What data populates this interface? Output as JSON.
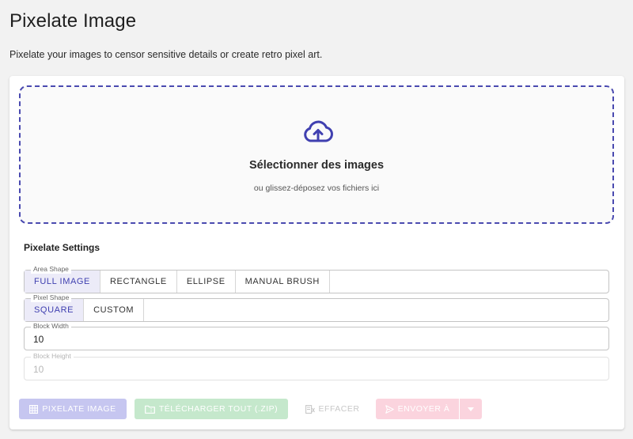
{
  "header": {
    "title": "Pixelate Image",
    "subtitle": "Pixelate your images to censor sensitive details or create retro pixel art."
  },
  "dropzone": {
    "title": "Sélectionner des images",
    "subtitle": "ou glissez-déposez vos fichiers ici",
    "icon": "cloud-upload-icon"
  },
  "settings": {
    "title": "Pixelate Settings",
    "area_shape": {
      "label": "Area Shape",
      "options": [
        "FULL IMAGE",
        "RECTANGLE",
        "ELLIPSE",
        "MANUAL BRUSH"
      ],
      "selected": "FULL IMAGE"
    },
    "pixel_shape": {
      "label": "Pixel Shape",
      "options": [
        "SQUARE",
        "CUSTOM"
      ],
      "selected": "SQUARE"
    },
    "block_width": {
      "label": "Block Width",
      "value": "10"
    },
    "block_height": {
      "label": "Block Height",
      "value": "10"
    }
  },
  "actions": {
    "pixelate": "PIXELATE IMAGE",
    "download": "TÉLÉCHARGER TOUT (.ZIP)",
    "clear": "EFFACER",
    "send": "ENVOYER À"
  },
  "colors": {
    "accent": "#4040b0",
    "dashed_border": "#4a4ab0",
    "selected_bg": "#ecebf8"
  }
}
